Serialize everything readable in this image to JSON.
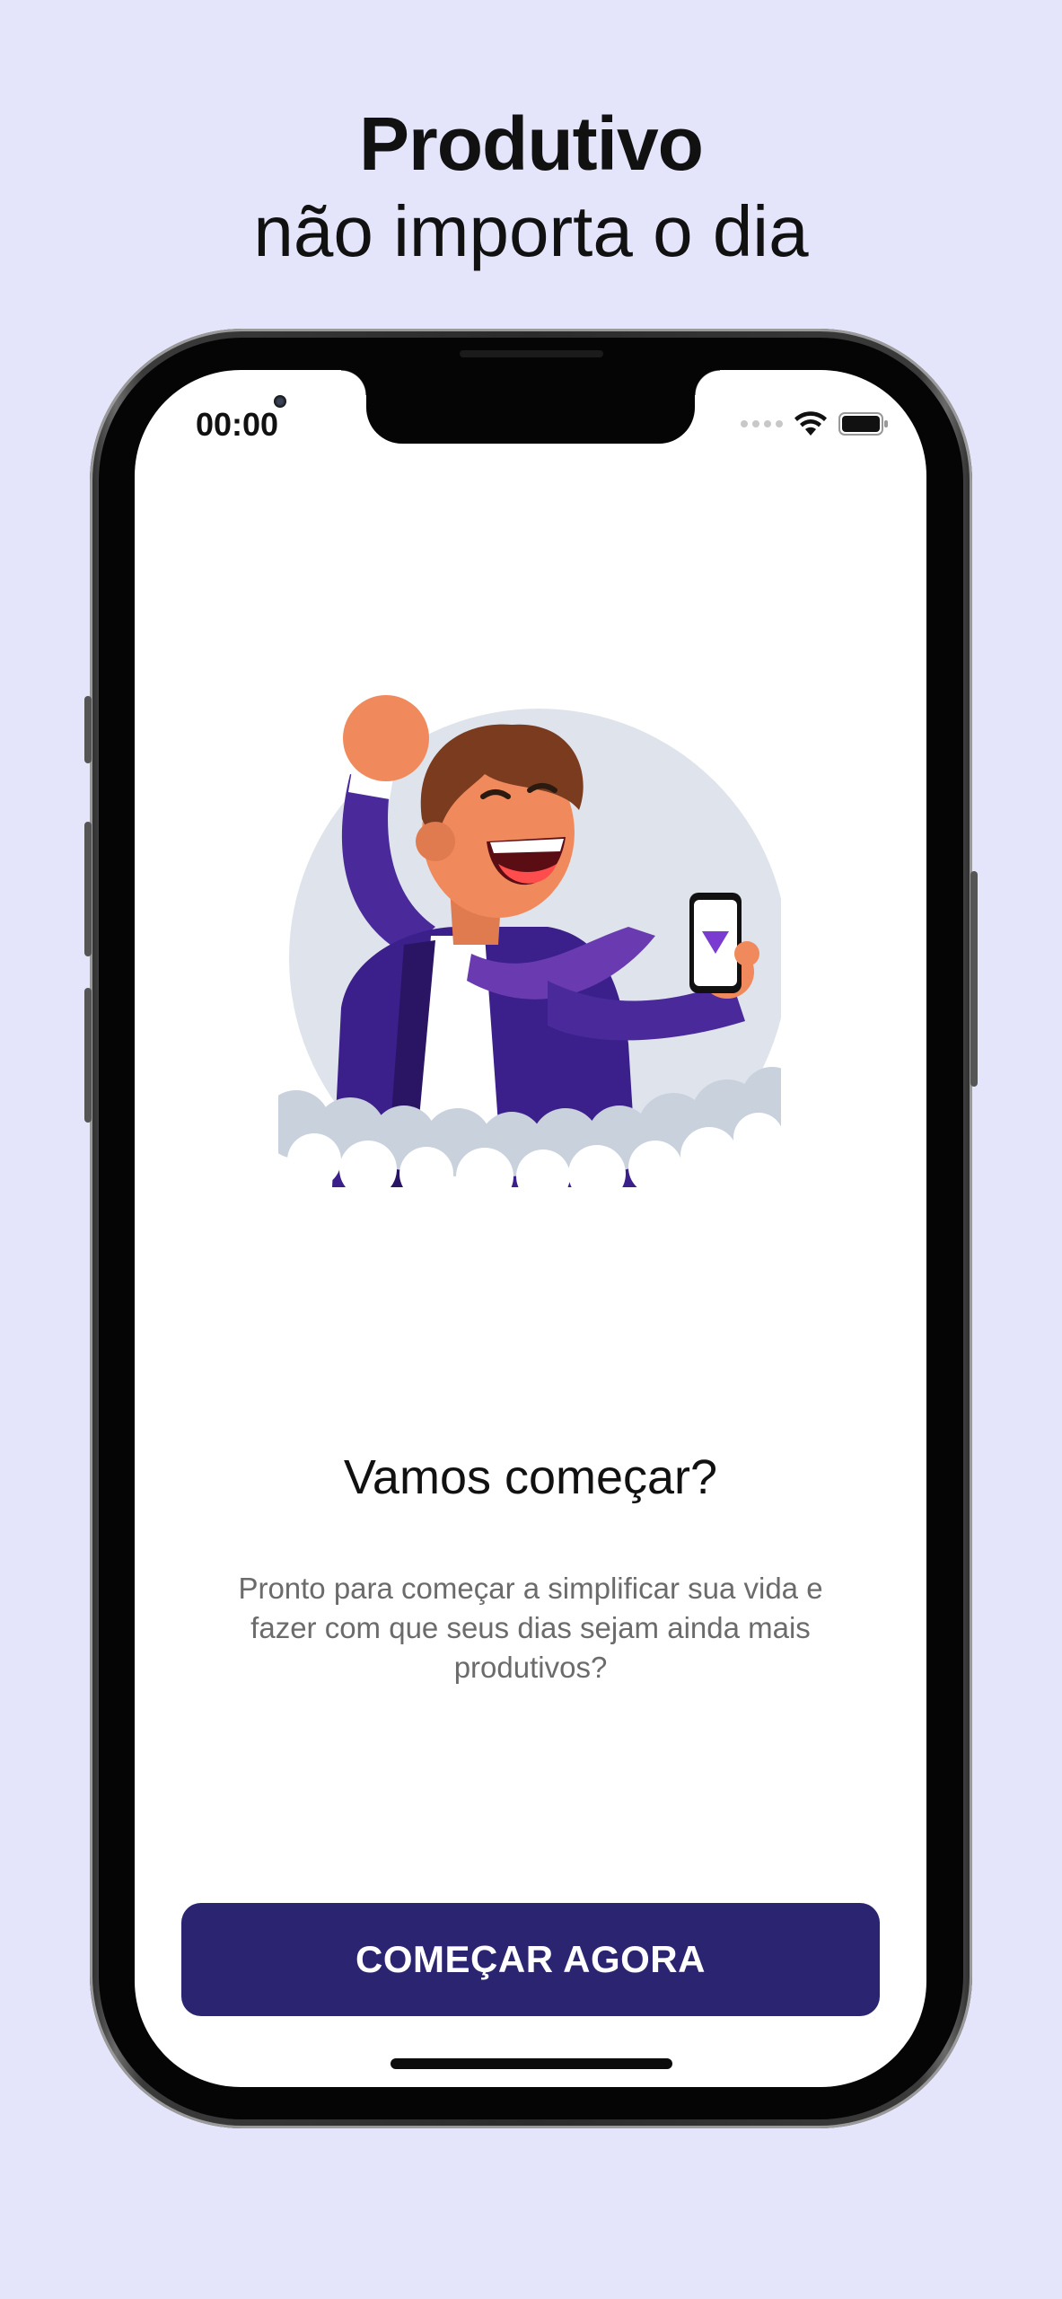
{
  "headline": {
    "line1": "Produtivo",
    "line2": "não importa o dia"
  },
  "status_bar": {
    "time": "00:00",
    "icons": [
      "signal-icon",
      "wifi-icon",
      "battery-icon"
    ]
  },
  "onboarding": {
    "illustration": "celebrating-person-with-phone-illustration",
    "title": "Vamos começar?",
    "description": "Pronto para começar a simplificar sua vida e fazer com que seus dias sejam ainda mais produtivos?",
    "cta_label": "COMEÇAR AGORA"
  },
  "colors": {
    "page_background": "#e4e5fb",
    "button": "#2b2470",
    "accent_purple": "#5b2aa6",
    "skin": "#f08a5d"
  }
}
